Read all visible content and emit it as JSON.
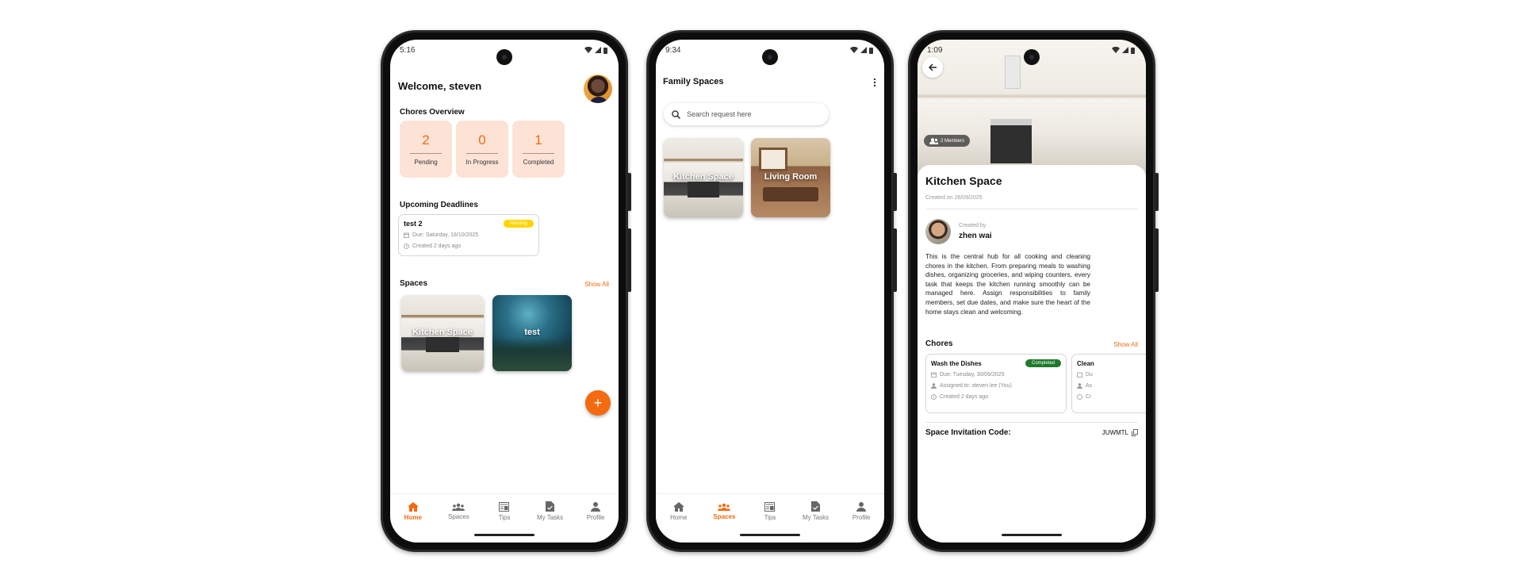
{
  "colors": {
    "accent": "#f36a10",
    "stat_bg": "#fde3d6",
    "pending_badge": "#ffd400",
    "completed_badge": "#1e7a2a"
  },
  "nav": {
    "home": "Home",
    "spaces": "Spaces",
    "tips": "Tips",
    "my_tasks": "My Tasks",
    "profile": "Profile"
  },
  "screen1": {
    "time": "5:16",
    "welcome": "Welcome, steven",
    "chores_overview": "Chores Overview",
    "stats": [
      {
        "value": "2",
        "label": "Pending"
      },
      {
        "value": "0",
        "label": "In Progress"
      },
      {
        "value": "1",
        "label": "Completed"
      }
    ],
    "upcoming_deadlines": "Upcoming Deadlines",
    "deadline": {
      "title": "test 2",
      "status": "Pending",
      "due": "Due: Saturday, 18/10/2025",
      "created": "Created 2 days ago"
    },
    "spaces_title": "Spaces",
    "show_all": "Show All",
    "spaces": [
      "Kitchen Space",
      "test"
    ],
    "fab": "+"
  },
  "screen2": {
    "time": "9:34",
    "title": "Family Spaces",
    "search_placeholder": "Search request here",
    "spaces": [
      "Kitchen Space",
      "Living Room"
    ]
  },
  "screen3": {
    "time": "1:09",
    "members": "2 Members",
    "title": "Kitchen Space",
    "created_on": "Created on 26/09/2025",
    "created_by": "Created by",
    "creator": "zhen wai",
    "description": "This is the central hub for all cooking and cleaning chores in the kitchen. From preparing meals to washing dishes, organizing groceries, and wiping counters, every task that keeps the kitchen running smoothly can be managed here. Assign responsibilities to family members, set due dates, and make sure the heart of the home stays clean and welcoming.",
    "chores_title": "Chores",
    "show_all": "Show All",
    "chore": {
      "title": "Wash the Dishes",
      "status": "Completed",
      "due": "Due: Tuesday, 30/09/2025",
      "assigned": "Assigned to: steven lee (You)",
      "created": "Created 2 days ago"
    },
    "chore2": {
      "title": "Clean",
      "due": "Du",
      "assigned": "As",
      "created": "Cr"
    },
    "invite_label": "Space Invitation Code:",
    "invite_code": "JUWMTL"
  }
}
